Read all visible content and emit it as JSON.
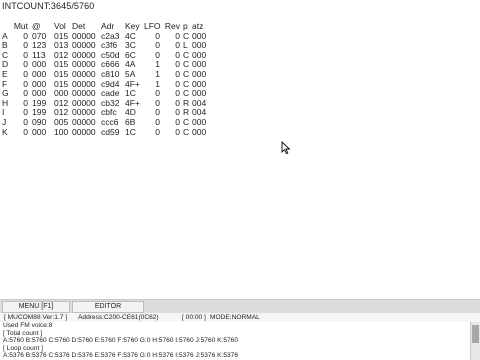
{
  "intcount": "INTCOUNT:3645/5760",
  "headers": {
    "mut": "Mut",
    "at": "@",
    "vol": "Vol",
    "det": "Det",
    "adr": "Adr",
    "key": "Key",
    "lfo": "LFO",
    "rev": "Rev",
    "p": "p",
    "atz": "atz"
  },
  "channels": [
    {
      "ch": "A",
      "mut": "0",
      "at": "070",
      "vol": "015",
      "det": "00000",
      "adr": "c2a3",
      "key": "4C",
      "lfo": "0",
      "rev": "0",
      "p": "C",
      "atz": "000"
    },
    {
      "ch": "B",
      "mut": "0",
      "at": "123",
      "vol": "013",
      "det": "00000",
      "adr": "c3f6",
      "key": "3C",
      "lfo": "0",
      "rev": "0",
      "p": "L",
      "atz": "000"
    },
    {
      "ch": "C",
      "mut": "0",
      "at": "113",
      "vol": "012",
      "det": "00000",
      "adr": "c50d",
      "key": "6C",
      "lfo": "0",
      "rev": "0",
      "p": "C",
      "atz": "000"
    },
    {
      "ch": "D",
      "mut": "0",
      "at": "000",
      "vol": "015",
      "det": "00000",
      "adr": "c666",
      "key": "4A",
      "lfo": "1",
      "rev": "0",
      "p": "C",
      "atz": "000"
    },
    {
      "ch": "E",
      "mut": "0",
      "at": "000",
      "vol": "015",
      "det": "00000",
      "adr": "c810",
      "key": "5A",
      "lfo": "1",
      "rev": "0",
      "p": "C",
      "atz": "000"
    },
    {
      "ch": "F",
      "mut": "0",
      "at": "000",
      "vol": "015",
      "det": "00000",
      "adr": "c9d4",
      "key": "4F+",
      "lfo": "1",
      "rev": "0",
      "p": "C",
      "atz": "000"
    },
    {
      "ch": "G",
      "mut": "0",
      "at": "000",
      "vol": "000",
      "det": "00000",
      "adr": "cade",
      "key": "1C",
      "lfo": "0",
      "rev": "0",
      "p": "C",
      "atz": "000"
    },
    {
      "ch": "H",
      "mut": "0",
      "at": "199",
      "vol": "012",
      "det": "00000",
      "adr": "cb32",
      "key": "4F+",
      "lfo": "0",
      "rev": "0",
      "p": "R",
      "atz": "004"
    },
    {
      "ch": "I",
      "mut": "0",
      "at": "199",
      "vol": "012",
      "det": "00000",
      "adr": "cbfc",
      "key": "4D",
      "lfo": "0",
      "rev": "0",
      "p": "R",
      "atz": "004"
    },
    {
      "ch": "J",
      "mut": "0",
      "at": "090",
      "vol": "005",
      "det": "00000",
      "adr": "ccc6",
      "key": "6B",
      "lfo": "0",
      "rev": "0",
      "p": "C",
      "atz": "000"
    },
    {
      "ch": "K",
      "mut": "0",
      "at": "000",
      "vol": "100",
      "det": "00000",
      "adr": "cd59",
      "key": "1C",
      "lfo": "0",
      "rev": "0",
      "p": "C",
      "atz": "000"
    }
  ],
  "tabs": {
    "menu": "MENU [F1]",
    "editor": "EDITOR"
  },
  "status": {
    "version": "[ MUCOM88 Ver:1.7 ]",
    "address": "Address:C200-CE61(0C62)",
    "time": "[ 00:00 ]",
    "mode": "MODE:NORMAL"
  },
  "console": {
    "line1": "Used FM voice:8",
    "line2": "[ Total count ]",
    "line3": "A:5760 B:5760 C:5760 D:5760 E:5760 F:5760 G:0 H:5760 I:5760 J:5760 K:5760",
    "line4": "[ Loop count ]",
    "line5": "A:5376 B:5376 C:5376 D:5376 E:5376 F:5376 G:0 H:5376 I:5376 J:5376 K:5376"
  },
  "icons": {
    "cursor": "mouse-pointer-icon"
  }
}
